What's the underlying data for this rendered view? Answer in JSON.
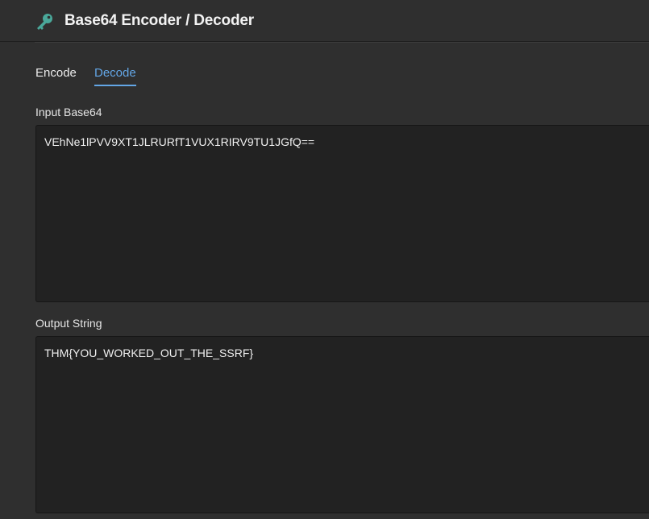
{
  "header": {
    "title": "Base64 Encoder / Decoder",
    "icon": "key-icon",
    "icon_color": "#4aa89a"
  },
  "tabs": [
    {
      "label": "Encode",
      "active": false
    },
    {
      "label": "Decode",
      "active": true
    }
  ],
  "accent_color": "#63a6e6",
  "input": {
    "label": "Input Base64",
    "value": "VEhNe1lPVV9XT1JLRURfT1VUX1RIRV9TU1JGfQ=="
  },
  "output": {
    "label": "Output String",
    "value": "THM{YOU_WORKED_OUT_THE_SSRF}"
  }
}
